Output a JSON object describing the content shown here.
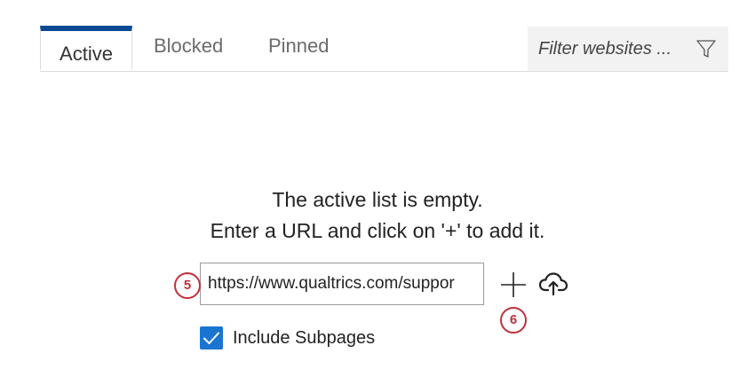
{
  "tabs": {
    "active": "Active",
    "blocked": "Blocked",
    "pinned": "Pinned"
  },
  "filter": {
    "placeholder": "Filter websites ...",
    "icon": "filter-icon"
  },
  "empty_state": {
    "line1": "The active list is empty.",
    "line2": "Enter a URL and click on '+' to add it."
  },
  "url_input": {
    "value": "https://www.qualtrics.com/suppor"
  },
  "actions": {
    "add_icon": "plus-icon",
    "upload_icon": "cloud-upload-icon"
  },
  "options": {
    "include_subpages_label": "Include Subpages",
    "include_subpages_checked": true
  },
  "annotations": {
    "badge_url": "5",
    "badge_add": "6"
  },
  "colors": {
    "accent": "#0a4a93",
    "checkbox": "#1a75d2",
    "annotation": "#c0313a"
  }
}
